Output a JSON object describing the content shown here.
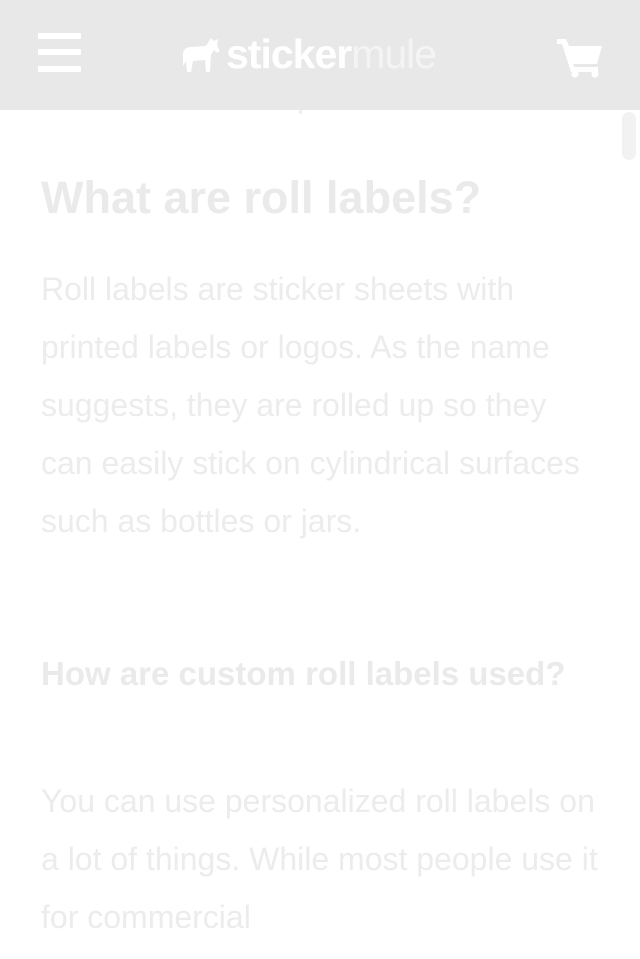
{
  "header": {
    "menu_icon": "hamburger-menu-icon",
    "logo": {
      "part1": "sticker",
      "part2": "mule"
    },
    "cart_icon": "shopping-cart-icon",
    "colors": {
      "header_bg": "#e8e8e8",
      "icons": "#ffffff"
    }
  },
  "article": {
    "heading": "What are roll labels?",
    "paragraph1": "Roll labels are sticker sheets with printed labels or logos. As the name suggests, they are rolled up so they can easily stick on cylindrical surfaces such as bottles or jars.",
    "subheading": "How are custom roll labels used?",
    "paragraph2": "You can use personalized roll labels on a lot of things. While most people use it for commercial"
  }
}
